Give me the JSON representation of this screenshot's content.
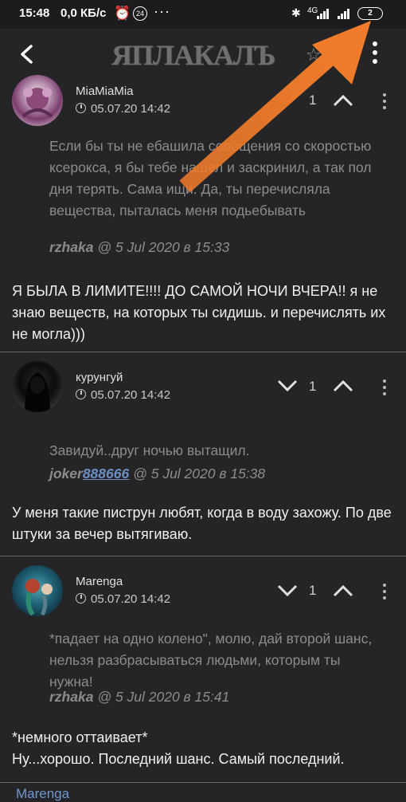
{
  "status_bar": {
    "time": "15:48",
    "network_speed": "0,0 КБ/с",
    "notification_count": "24",
    "more_dots": "···",
    "battery": "2",
    "network_type": "4G"
  },
  "header": {
    "logo_text": "ЯПЛАКАЛЪ",
    "icons": [
      "back-arrow-icon",
      "star-icon",
      "more-vertical-icon"
    ]
  },
  "posts": [
    {
      "author": "MiaMiaMia",
      "date": "05.07.20 14:42",
      "rating": "1",
      "quote": "Если бы ты не ебашила сообщения со скоростью ксерокса, я бы тебе нашел и заскринил, а так пол дня терять. Сама ищи. Да, ты перечисляла вещества, пыталась меня подьебывать",
      "quote_author": "rzhaka",
      "quote_meta": " @ 5 Jul 2020 в 15:33",
      "text": "Я БЫЛА В ЛИМИТЕ!!!! ДО САМОЙ НОЧИ ВЧЕРА!! я не знаю веществ, на которых ты сидишь. и перечислять их не могла)))"
    },
    {
      "author": "курунгуй",
      "date": "05.07.20 14:42",
      "rating": "1",
      "quote": "Завидуй..друг ночью вытащил.",
      "quote_author_prefix": "joker",
      "quote_author_link": "888666",
      "quote_meta": " @ 5 Jul 2020 в 15:38",
      "text": "У меня такие пиструн любят, когда в воду захожу. По две штуки за вечер вытягиваю."
    },
    {
      "author": "Marenga",
      "date": "05.07.20 14:42",
      "rating": "1",
      "quote": "*падает на одно колено\", молю, дай второй шанс, нельзя разбрасываться людьми, которым ты нужна!",
      "quote_author": "rzhaka",
      "quote_meta": " @ 5 Jul 2020 в 15:41",
      "text_line1": "*немного оттаивает*",
      "text_line2": "Ну...хорошо. Последний шанс. Самый последний."
    }
  ],
  "next_author_partial": "Marenga",
  "colors": {
    "background": "#252527",
    "link": "#6c8ec4",
    "quote_text": "#8c8c8c",
    "arrow": "#f07b2a",
    "downvote_active": "#d9485a"
  }
}
